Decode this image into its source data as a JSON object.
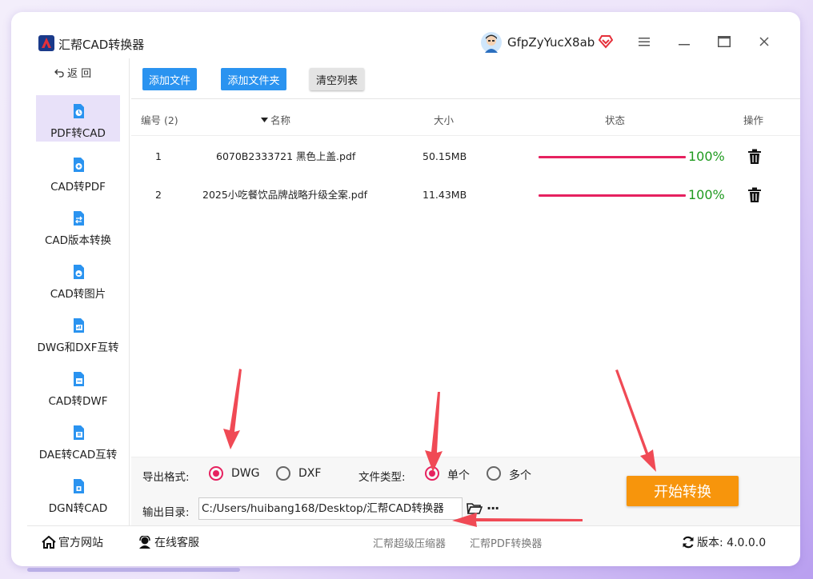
{
  "app": {
    "title": "汇帮CAD转换器",
    "username": "GfpZyYucX8ab"
  },
  "sidebar": {
    "back_label": "返 回",
    "items": [
      {
        "label": "PDF转CAD",
        "active": true
      },
      {
        "label": "CAD转PDF",
        "active": false
      },
      {
        "label": "CAD版本转换",
        "active": false
      },
      {
        "label": "CAD转图片",
        "active": false
      },
      {
        "label": "DWG和DXF互转",
        "active": false
      },
      {
        "label": "CAD转DWF",
        "active": false
      },
      {
        "label": "DAE转CAD互转",
        "active": false
      },
      {
        "label": "DGN转CAD",
        "active": false
      }
    ]
  },
  "toolbar": {
    "add_file": "添加文件",
    "add_folder": "添加文件夹",
    "clear_list": "清空列表"
  },
  "table": {
    "headers": {
      "index": "编号 (2)",
      "name": "名称",
      "size": "大小",
      "status": "状态",
      "action": "操作"
    },
    "rows": [
      {
        "index": "1",
        "name": "6070B2333721 黑色上盖.pdf",
        "size": "50.15MB",
        "progress": 100,
        "progress_text": "100%"
      },
      {
        "index": "2",
        "name": "2025小吃餐饮品牌战略升级全案.pdf",
        "size": "11.43MB",
        "progress": 100,
        "progress_text": "100%"
      }
    ]
  },
  "settings": {
    "format_label": "导出格式:",
    "format_options": [
      {
        "label": "DWG",
        "selected": true
      },
      {
        "label": "DXF",
        "selected": false
      }
    ],
    "filetype_label": "文件类型:",
    "filetype_options": [
      {
        "label": "单个",
        "selected": true
      },
      {
        "label": "多个",
        "selected": false
      }
    ],
    "output_label": "输出目录:",
    "output_path": "C:/Users/huibang168/Desktop/汇帮CAD转换器",
    "more_label": "···",
    "start_button": "开始转换"
  },
  "footer": {
    "website": "官方网站",
    "support": "在线客服",
    "link1": "汇帮超级压缩器",
    "link2": "汇帮PDF转换器",
    "version": "版本: 4.0.0.0"
  },
  "colors": {
    "accent_blue": "#2a93f0",
    "progress": "#e6215f",
    "success_text": "#1f9a1f",
    "start_button": "#f7950c",
    "sidebar_active": "#e8e1f9",
    "arrow": "#f04a55"
  }
}
